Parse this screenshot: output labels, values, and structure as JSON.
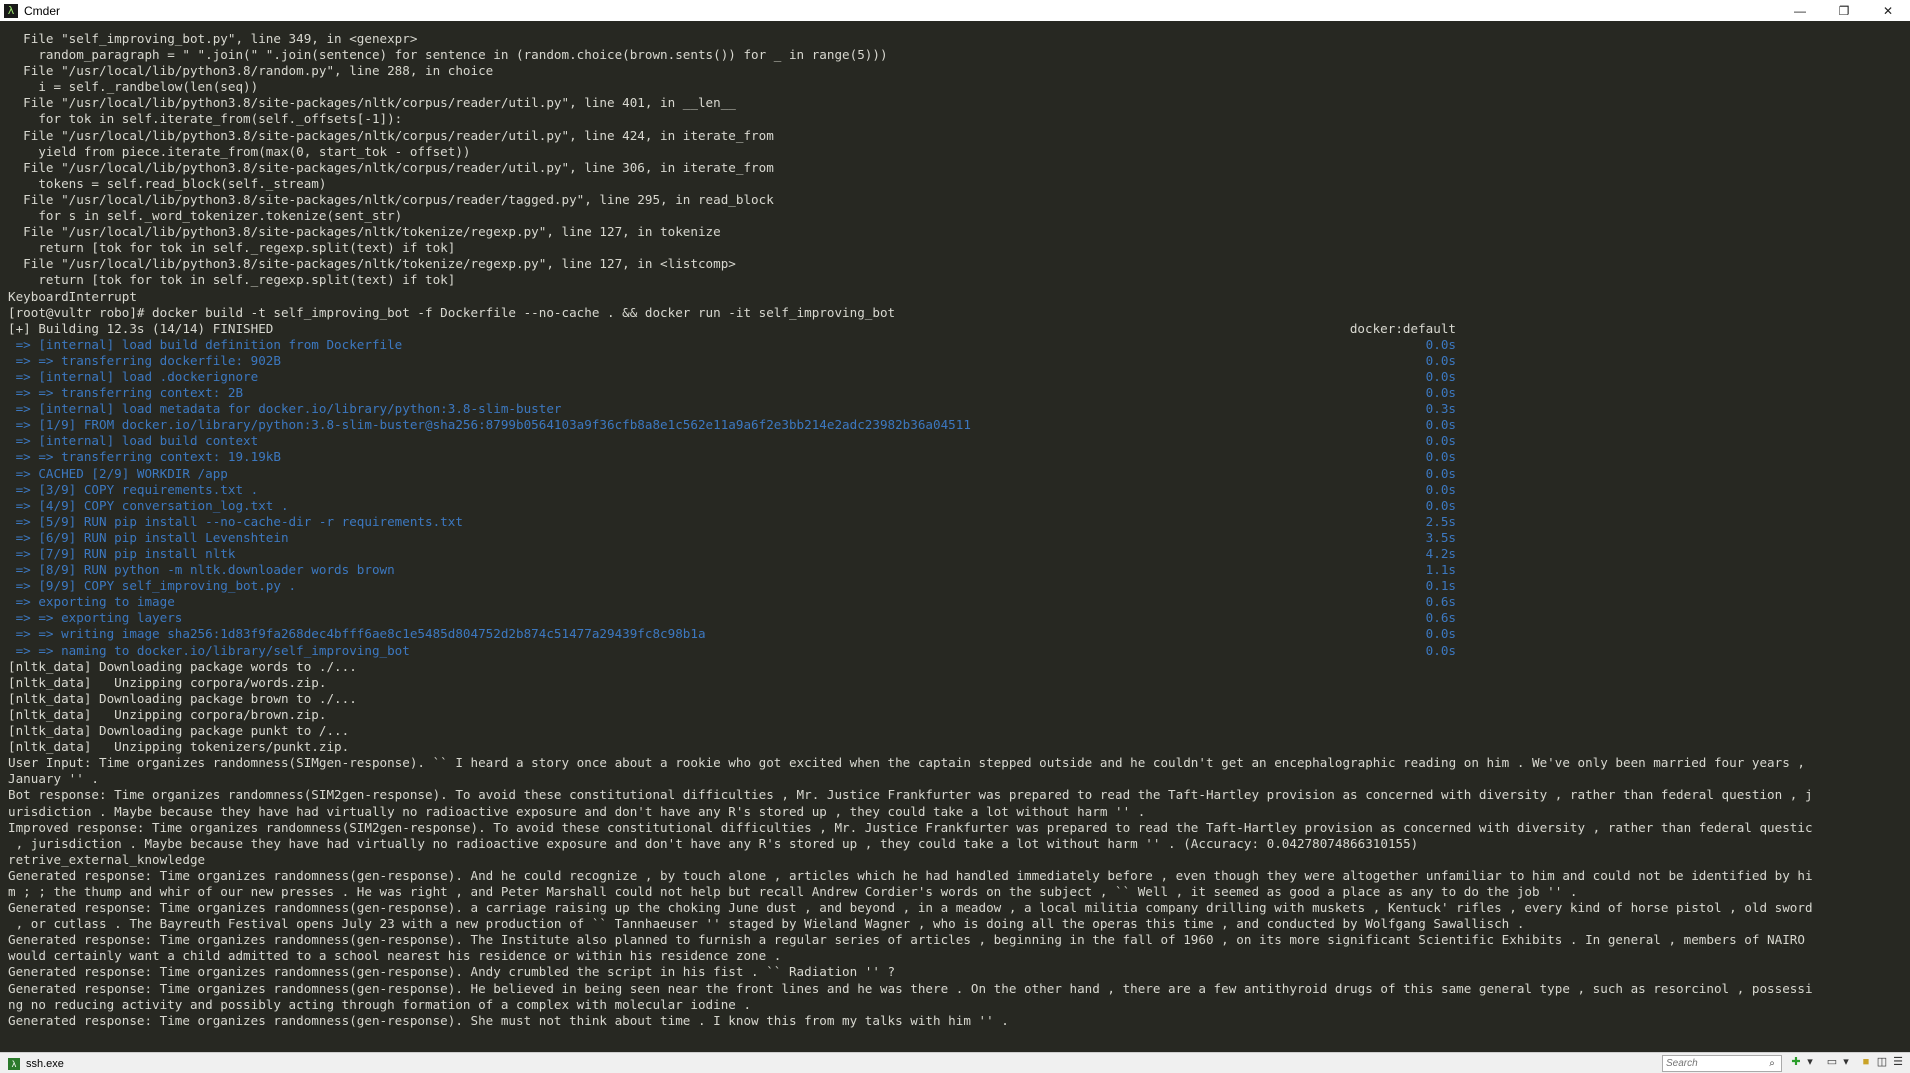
{
  "window": {
    "title": "Cmder",
    "app_icon": "λ",
    "minimize": "—",
    "restore": "❐",
    "close": "✕"
  },
  "terminal": {
    "lines": [
      {
        "text": "  File \"self_improving_bot.py\", line 349, in <genexpr>"
      },
      {
        "text": "    random_paragraph = \" \".join(\" \".join(sentence) for sentence in (random.choice(brown.sents()) for _ in range(5)))"
      },
      {
        "text": "  File \"/usr/local/lib/python3.8/random.py\", line 288, in choice"
      },
      {
        "text": "    i = self._randbelow(len(seq))"
      },
      {
        "text": "  File \"/usr/local/lib/python3.8/site-packages/nltk/corpus/reader/util.py\", line 401, in __len__"
      },
      {
        "text": "    for tok in self.iterate_from(self._offsets[-1]):"
      },
      {
        "text": "  File \"/usr/local/lib/python3.8/site-packages/nltk/corpus/reader/util.py\", line 424, in iterate_from"
      },
      {
        "text": "    yield from piece.iterate_from(max(0, start_tok - offset))"
      },
      {
        "text": "  File \"/usr/local/lib/python3.8/site-packages/nltk/corpus/reader/util.py\", line 306, in iterate_from"
      },
      {
        "text": "    tokens = self.read_block(self._stream)"
      },
      {
        "text": "  File \"/usr/local/lib/python3.8/site-packages/nltk/corpus/reader/tagged.py\", line 295, in read_block"
      },
      {
        "text": "    for s in self._word_tokenizer.tokenize(sent_str)"
      },
      {
        "text": "  File \"/usr/local/lib/python3.8/site-packages/nltk/tokenize/regexp.py\", line 127, in tokenize"
      },
      {
        "text": "    return [tok for tok in self._regexp.split(text) if tok]"
      },
      {
        "text": "  File \"/usr/local/lib/python3.8/site-packages/nltk/tokenize/regexp.py\", line 127, in <listcomp>"
      },
      {
        "text": "    return [tok for tok in self._regexp.split(text) if tok]"
      },
      {
        "text": "KeyboardInterrupt"
      },
      {
        "text": "[root@vultr robo]# docker build -t self_improving_bot -f Dockerfile --no-cache . && docker run -it self_improving_bot"
      },
      {
        "text": "[+] Building 12.3s (14/14) FINISHED",
        "right": "docker:default"
      },
      {
        "text": " => [internal] load build definition from Dockerfile",
        "right": "0.0s",
        "blue": true
      },
      {
        "text": " => => transferring dockerfile: 902B",
        "right": "0.0s",
        "blue": true
      },
      {
        "text": " => [internal] load .dockerignore",
        "right": "0.0s",
        "blue": true
      },
      {
        "text": " => => transferring context: 2B",
        "right": "0.0s",
        "blue": true
      },
      {
        "text": " => [internal] load metadata for docker.io/library/python:3.8-slim-buster",
        "right": "0.3s",
        "blue": true
      },
      {
        "text": " => [1/9] FROM docker.io/library/python:3.8-slim-buster@sha256:8799b0564103a9f36cfb8a8e1c562e11a9a6f2e3bb214e2adc23982b36a04511",
        "right": "0.0s",
        "blue": true
      },
      {
        "text": " => [internal] load build context",
        "right": "0.0s",
        "blue": true
      },
      {
        "text": " => => transferring context: 19.19kB",
        "right": "0.0s",
        "blue": true
      },
      {
        "text": " => CACHED [2/9] WORKDIR /app",
        "right": "0.0s",
        "blue": true
      },
      {
        "text": " => [3/9] COPY requirements.txt .",
        "right": "0.0s",
        "blue": true
      },
      {
        "text": " => [4/9] COPY conversation_log.txt .",
        "right": "0.0s",
        "blue": true
      },
      {
        "text": " => [5/9] RUN pip install --no-cache-dir -r requirements.txt",
        "right": "2.5s",
        "blue": true
      },
      {
        "text": " => [6/9] RUN pip install Levenshtein",
        "right": "3.5s",
        "blue": true
      },
      {
        "text": " => [7/9] RUN pip install nltk",
        "right": "4.2s",
        "blue": true
      },
      {
        "text": " => [8/9] RUN python -m nltk.downloader words brown",
        "right": "1.1s",
        "blue": true
      },
      {
        "text": " => [9/9] COPY self_improving_bot.py .",
        "right": "0.1s",
        "blue": true
      },
      {
        "text": " => exporting to image",
        "right": "0.6s",
        "blue": true
      },
      {
        "text": " => => exporting layers",
        "right": "0.6s",
        "blue": true
      },
      {
        "text": " => => writing image sha256:1d83f9fa268dec4bfff6ae8c1e5485d804752d2b874c51477a29439fc8c98b1a",
        "right": "0.0s",
        "blue": true
      },
      {
        "text": " => => naming to docker.io/library/self_improving_bot",
        "right": "0.0s",
        "blue": true
      },
      {
        "text": "[nltk_data] Downloading package words to ./..."
      },
      {
        "text": "[nltk_data]   Unzipping corpora/words.zip."
      },
      {
        "text": "[nltk_data] Downloading package brown to ./..."
      },
      {
        "text": "[nltk_data]   Unzipping corpora/brown.zip."
      },
      {
        "text": "[nltk_data] Downloading package punkt to /..."
      },
      {
        "text": "[nltk_data]   Unzipping tokenizers/punkt.zip."
      },
      {
        "text": "User Input: Time organizes randomness(SIMgen-response). `` I heard a story once about a rookie who got excited when the captain stepped outside and he couldn't get an encephalographic reading on him . We've only been married four years ,"
      },
      {
        "text": "January '' ."
      },
      {
        "text": "Bot response: Time organizes randomness(SIM2gen-response). To avoid these constitutional difficulties , Mr. Justice Frankfurter was prepared to read the Taft-Hartley provision as concerned with diversity , rather than federal question , j"
      },
      {
        "text": "urisdiction . Maybe because they have had virtually no radioactive exposure and don't have any R's stored up , they could take a lot without harm '' ."
      },
      {
        "text": "Improved response: Time organizes randomness(SIM2gen-response). To avoid these constitutional difficulties , Mr. Justice Frankfurter was prepared to read the Taft-Hartley provision as concerned with diversity , rather than federal questic"
      },
      {
        "text": " , jurisdiction . Maybe because they have had virtually no radioactive exposure and don't have any R's stored up , they could take a lot without harm '' . (Accuracy: 0.04278074866310155)"
      },
      {
        "text": "retrive_external_knowledge"
      },
      {
        "text": "Generated response: Time organizes randomness(gen-response). And he could recognize , by touch alone , articles which he had handled immediately before , even though they were altogether unfamiliar to him and could not be identified by hi"
      },
      {
        "text": "m ; ; the thump and whir of our new presses . He was right , and Peter Marshall could not help but recall Andrew Cordier's words on the subject , `` Well , it seemed as good a place as any to do the job '' ."
      },
      {
        "text": "Generated response: Time organizes randomness(gen-response). a carriage raising up the choking June dust , and beyond , in a meadow , a local militia company drilling with muskets , Kentuck' rifles , every kind of horse pistol , old sword"
      },
      {
        "text": " , or cutlass . The Bayreuth Festival opens July 23 with a new production of `` Tannhaeuser '' staged by Wieland Wagner , who is doing all the operas this time , and conducted by Wolfgang Sawallisch ."
      },
      {
        "text": "Generated response: Time organizes randomness(gen-response). The Institute also planned to furnish a regular series of articles , beginning in the fall of 1960 , on its more significant Scientific Exhibits . In general , members of NAIRO"
      },
      {
        "text": "would certainly want a child admitted to a school nearest his residence or within his residence zone ."
      },
      {
        "text": "Generated response: Time organizes randomness(gen-response). Andy crumbled the script in his fist . `` Radiation '' ?"
      },
      {
        "text": "Generated response: Time organizes randomness(gen-response). He believed in being seen near the front lines and he was there . On the other hand , there are a few antithyroid drugs of this same general type , such as resorcinol , possessi"
      },
      {
        "text": "ng no reducing activity and possibly acting through formation of a complex with molecular iodine ."
      },
      {
        "text": "Generated response: Time organizes randomness(gen-response). She must not think about time . I know this from my talks with him '' ."
      }
    ]
  },
  "statusbar": {
    "tab_label": "ssh.exe",
    "search_placeholder": "Search",
    "search_icon": "⌕"
  },
  "colors": {
    "background": "#272822",
    "text": "#d8d8d0",
    "build_step_blue": "#3c78c0"
  }
}
